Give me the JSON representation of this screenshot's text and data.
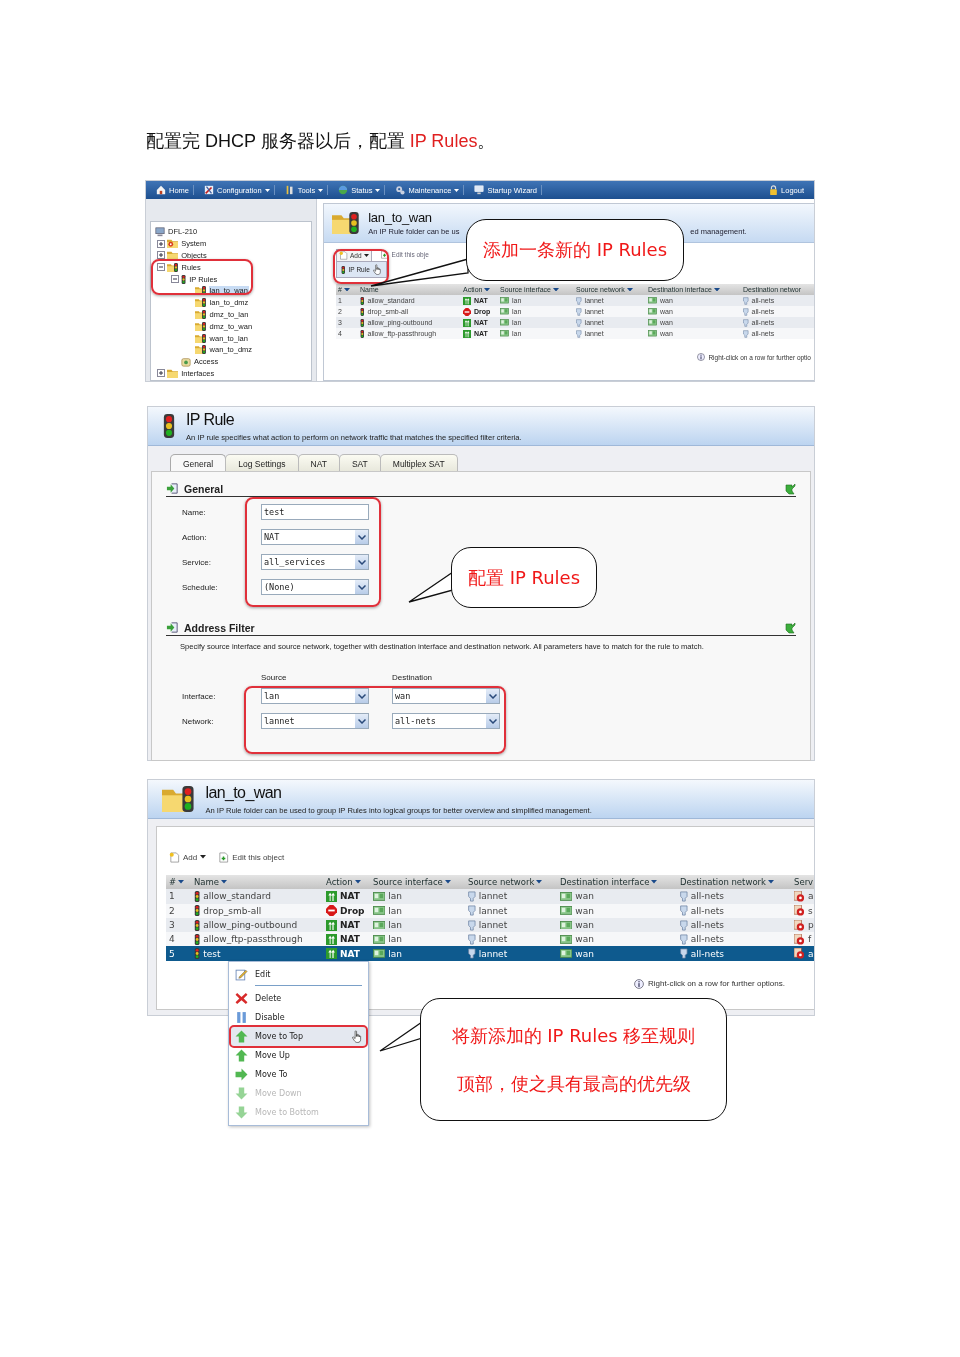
{
  "intro": [
    {
      "kind": "plain",
      "text": "配置完 DHCP 服务器以后，配置 "
    },
    {
      "kind": "accent",
      "text": "IP Rules"
    },
    {
      "kind": "plain",
      "text": "。"
    }
  ],
  "figure_1": {
    "menu": [
      {
        "label": "Home",
        "dropdown": false
      },
      {
        "label": "Configuration",
        "dropdown": true
      },
      {
        "label": "Tools",
        "dropdown": true
      },
      {
        "label": "Status",
        "dropdown": true
      },
      {
        "label": "Maintenance",
        "dropdown": true
      },
      {
        "label": "Startup Wizard",
        "dropdown": false
      }
    ],
    "logout": "Logout",
    "tree": [
      {
        "label": "DFL-210",
        "kind": "device",
        "children": [
          {
            "label": "System",
            "kind": "system",
            "expanded": false
          },
          {
            "label": "Objects",
            "kind": "folder",
            "expanded": false
          },
          {
            "label": "Rules",
            "kind": "rule-folder",
            "expanded": true,
            "children": [
              {
                "label": "IP Rules",
                "kind": "rules",
                "expanded": true,
                "children": [
                  {
                    "label": "lan_to_wan",
                    "kind": "rule-folder",
                    "selected": true
                  },
                  {
                    "label": "lan_to_dmz",
                    "kind": "rule-folder",
                    "selected": false
                  },
                  {
                    "label": "dmz_to_lan",
                    "kind": "rule-folder",
                    "selected": false
                  },
                  {
                    "label": "dmz_to_wan",
                    "kind": "rule-folder",
                    "selected": false
                  },
                  {
                    "label": "wan_to_lan",
                    "kind": "rule-folder",
                    "selected": false
                  },
                  {
                    "label": "wan_to_dmz",
                    "kind": "rule-folder",
                    "selected": false
                  }
                ]
              },
              {
                "label": "Access",
                "kind": "access"
              }
            ]
          },
          {
            "label": "Interfaces",
            "kind": "folder",
            "expanded": false
          }
        ]
      }
    ],
    "panel": {
      "title": "lan_to_wan",
      "description_start": "An IP Rule folder can be us",
      "description_end": "ed management.",
      "add": "Add",
      "add_menu": [
        "IP Rule"
      ],
      "edit": "Edit this obje",
      "columns": [
        {
          "label": "#",
          "sortable": true
        },
        {
          "label": "Name",
          "sortable": false
        },
        {
          "label": "Action",
          "sortable": true
        },
        {
          "label": "Source interface",
          "sortable": true
        },
        {
          "label": "Source network",
          "sortable": true
        },
        {
          "label": "Destination interface",
          "sortable": true
        },
        {
          "label": "Destination networ",
          "sortable": false
        }
      ],
      "rows": [
        {
          "number": "1",
          "name": "allow_standard",
          "kind": "allow",
          "action": "NAT",
          "source_interface": "lan",
          "source_network": "lannet",
          "destination_interface": "wan",
          "destination_network": "all-nets"
        },
        {
          "number": "2",
          "name": "drop_smb-all",
          "kind": "drop",
          "action": "Drop",
          "source_interface": "lan",
          "source_network": "lannet",
          "destination_interface": "wan",
          "destination_network": "all-nets"
        },
        {
          "number": "3",
          "name": "allow_ping-outbound",
          "kind": "allow",
          "action": "NAT",
          "source_interface": "lan",
          "source_network": "lannet",
          "destination_interface": "wan",
          "destination_network": "all-nets"
        },
        {
          "number": "4",
          "name": "allow_ftp-passthrough",
          "kind": "allow",
          "action": "NAT",
          "source_interface": "lan",
          "source_network": "lannet",
          "destination_interface": "wan",
          "destination_network": "all-nets"
        }
      ],
      "hint": "Right-click on a row for further optio"
    },
    "callout": "添加一条新的 IP Rules"
  },
  "figure_2": {
    "title": "IP Rule",
    "description": "An IP rule specifies what action to perform on network traffic that matches the specified filter criteria.",
    "tabs": [
      {
        "label": "General",
        "selected": true
      },
      {
        "label": "Log Settings",
        "selected": false
      },
      {
        "label": "NAT",
        "selected": false
      },
      {
        "label": "SAT",
        "selected": false
      },
      {
        "label": "Multiplex SAT",
        "selected": false
      }
    ],
    "general": {
      "title": "General",
      "fields": [
        {
          "label": "Name:",
          "kind": "text",
          "value": "test"
        },
        {
          "label": "Action:",
          "kind": "select",
          "value": "NAT"
        },
        {
          "label": "Service:",
          "kind": "select",
          "value": "all_services"
        },
        {
          "label": "Schedule:",
          "kind": "select",
          "value": "(None)"
        }
      ]
    },
    "address_filter": {
      "title": "Address Filter",
      "description": "Specify source interface and source network, together with destination interface and destination network. All parameters have to match for the rule to match.",
      "columns": [
        "Source",
        "Destination"
      ],
      "rows": [
        {
          "label": "Interface:",
          "source": "lan",
          "destination": "wan"
        },
        {
          "label": "Network:",
          "source": "lannet",
          "destination": "all-nets"
        }
      ]
    },
    "callout": "配置 IP Rules"
  },
  "figure_3": {
    "title": "lan_to_wan",
    "description": "An IP Rule folder can be used to group IP Rules into logical groups for better overview and simplified management.",
    "add": "Add",
    "edit": "Edit this object",
    "columns": [
      {
        "label": "#",
        "sortable": true
      },
      {
        "label": "Name",
        "sortable": true
      },
      {
        "label": "Action",
        "sortable": true
      },
      {
        "label": "Source interface",
        "sortable": true
      },
      {
        "label": "Source network",
        "sortable": true
      },
      {
        "label": "Destination interface",
        "sortable": true
      },
      {
        "label": "Destination network",
        "sortable": true
      },
      {
        "label": "Serv"
      }
    ],
    "rows": [
      {
        "number": "1",
        "name": "allow_standard",
        "kind": "allow",
        "action": "NAT",
        "source_interface": "lan",
        "source_network": "lannet",
        "destination_interface": "wan",
        "destination_network": "all-nets",
        "service": "a",
        "selected": false
      },
      {
        "number": "2",
        "name": "drop_smb-all",
        "kind": "drop",
        "action": "Drop",
        "source_interface": "lan",
        "source_network": "lannet",
        "destination_interface": "wan",
        "destination_network": "all-nets",
        "service": "s",
        "selected": false
      },
      {
        "number": "3",
        "name": "allow_ping-outbound",
        "kind": "allow",
        "action": "NAT",
        "source_interface": "lan",
        "source_network": "lannet",
        "destination_interface": "wan",
        "destination_network": "all-nets",
        "service": "p",
        "selected": false
      },
      {
        "number": "4",
        "name": "allow_ftp-passthrough",
        "kind": "allow",
        "action": "NAT",
        "source_interface": "lan",
        "source_network": "lannet",
        "destination_interface": "wan",
        "destination_network": "all-nets",
        "service": "f",
        "selected": false
      },
      {
        "number": "5",
        "name": "test",
        "kind": "allow",
        "action": "NAT",
        "source_interface": "lan",
        "source_network": "lannet",
        "destination_interface": "wan",
        "destination_network": "all-nets",
        "service": "a",
        "selected": true
      }
    ],
    "hint": "Right-click on a row for further options.",
    "context_menu": [
      {
        "label": "Edit",
        "kind": "edit",
        "disabled": false,
        "selected": false
      },
      {
        "label": "Delete",
        "kind": "delete",
        "disabled": false,
        "selected": false
      },
      {
        "label": "Disable",
        "kind": "disable",
        "disabled": false,
        "selected": false
      },
      {
        "label": "Move to Top",
        "kind": "up",
        "disabled": false,
        "selected": true
      },
      {
        "label": "Move Up",
        "kind": "up",
        "disabled": false,
        "selected": false
      },
      {
        "label": "Move To",
        "kind": "right",
        "disabled": false,
        "selected": false
      },
      {
        "label": "Move Down",
        "kind": "down",
        "disabled": true,
        "selected": false
      },
      {
        "label": "Move to Bottom",
        "kind": "down",
        "disabled": true,
        "selected": false
      }
    ],
    "callout": [
      "将新添加的 IP Rules 移至规则",
      "顶部，使之具有最高的优先级"
    ]
  }
}
